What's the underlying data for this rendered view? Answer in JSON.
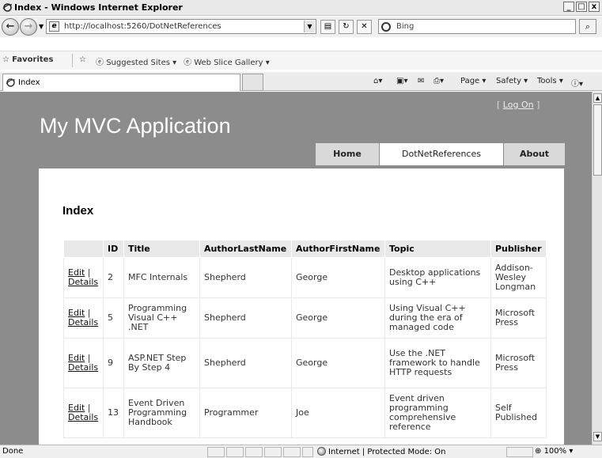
{
  "window": {
    "title": "Index - Windows Internet Explorer",
    "minimize": "_",
    "maximize": "□",
    "close": "x"
  },
  "address_bar": {
    "url": "http://localhost:5260/DotNetReferences",
    "search_placeholder": "Bing"
  },
  "favorites_bar": {
    "favorites": "Favorites",
    "suggested_sites": "Suggested Sites ▾",
    "web_slice_gallery": "Web Slice Gallery ▾"
  },
  "tab": {
    "label": "Index"
  },
  "command_bar": {
    "page": "Page ▾",
    "safety": "Safety ▾",
    "tools": "Tools ▾",
    "help": "▾"
  },
  "site": {
    "log_on": {
      "prefix": "[ ",
      "link": "Log On",
      "suffix": " ]"
    },
    "app_title": "My MVC Application",
    "menu": [
      {
        "label": "Home"
      },
      {
        "label": "DotNetReferences"
      },
      {
        "label": "About"
      }
    ],
    "page_title": "Index"
  },
  "table": {
    "columns": [
      "",
      "ID",
      "Title",
      "AuthorLastName",
      "AuthorFirstName",
      "Topic",
      "Publisher"
    ],
    "rows": [
      {
        "edit": "Edit",
        "details": "Details",
        "id": "2",
        "title": "MFC Internals",
        "last": "Shepherd",
        "first": "George",
        "topic": "Desktop applications using C++",
        "publisher": "Addison-Wesley Longman"
      },
      {
        "edit": "Edit",
        "details": "Details",
        "id": "5",
        "title": "Programming Visual C++ .NET",
        "last": "Shepherd",
        "first": "George",
        "topic": "Using Visual C++ during the era of managed code",
        "publisher": "Microsoft Press"
      },
      {
        "edit": "Edit",
        "details": "Details",
        "id": "9",
        "title": "ASP.NET Step By Step 4",
        "last": "Shepherd",
        "first": "George",
        "topic": "Use the .NET framework to handle HTTP requests",
        "publisher": "Microsoft Press"
      },
      {
        "edit": "Edit",
        "details": "Details",
        "id": "13",
        "title": "Event Driven Programming Handbook",
        "last": "Programmer",
        "first": "Joe",
        "topic": "Event driven programming comprehensive reference",
        "publisher": "Self Published"
      }
    ]
  },
  "status_bar": {
    "status": "Done",
    "zone": "Internet | Protected Mode: On",
    "zoom": "100%"
  },
  "colors": {
    "page_background": "#8c8c8c",
    "menu_tab": "#d9d9d9",
    "header_row": "#e9e9e9"
  }
}
